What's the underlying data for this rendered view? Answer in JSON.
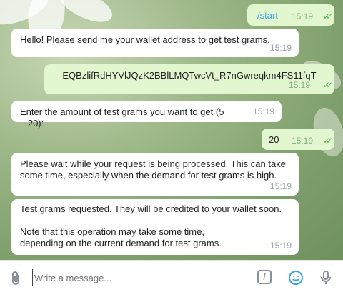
{
  "messages": [
    {
      "text": "/start",
      "time": "15:19",
      "dir": "out"
    },
    {
      "text": "Hello! Please send me your wallet address to get test grams.",
      "time": "15:19",
      "dir": "in"
    },
    {
      "text": "EQBzlifRdHYVlJQzK2BBlLMQTwcVt_R7nGwreqkm4FS11fqT",
      "time": "15:19",
      "dir": "out"
    },
    {
      "text": "Enter the amount of test grams you want to get (5 – 20):",
      "time": "15:19",
      "dir": "in"
    },
    {
      "text": "20",
      "time": "15:19",
      "dir": "out"
    },
    {
      "text": "Please wait while your request is being processed. This can take some time, especially when the demand for test grams is high.",
      "time": "15:19",
      "dir": "in"
    },
    {
      "text": "Test grams requested. They will be credited to your wallet soon.",
      "text2": "Note that this operation may take some time, depending on the current demand for test grams.",
      "time": "15:19",
      "dir": "in"
    }
  ],
  "composer": {
    "placeholder": "Write a message...",
    "attach_icon": "paperclip-icon",
    "command_icon": "slash-command-icon",
    "emoji_icon": "emoji-icon",
    "mic_icon": "microphone-icon"
  },
  "colors": {
    "outgoing_bubble": "#e2f6d0",
    "incoming_bubble": "#ffffff",
    "check": "#5fb85b",
    "accent": "#3aa3e3"
  }
}
